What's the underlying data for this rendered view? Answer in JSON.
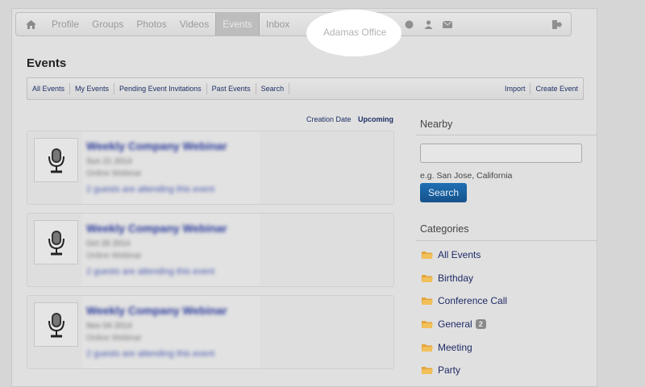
{
  "nav": {
    "items": [
      "Profile",
      "Groups",
      "Photos",
      "Videos",
      "Events",
      "Inbox"
    ],
    "office": "Adamas Office"
  },
  "page_title": "Events",
  "subnav": {
    "left": [
      "All Events",
      "My Events",
      "Pending Event Invitations",
      "Past Events",
      "Search"
    ],
    "right": [
      "Import",
      "Create Event"
    ]
  },
  "sort": {
    "creation": "Creation Date",
    "upcoming": "Upcoming"
  },
  "events": [
    {
      "title": "Weekly Company Webinar",
      "date": "Sun 21 2014",
      "type": "Online Webinar",
      "attending": "2 guests are attending this event"
    },
    {
      "title": "Weekly Company Webinar",
      "date": "Oct 28 2014",
      "type": "Online Webinar",
      "attending": "2 guests are attending this event"
    },
    {
      "title": "Weekly Company Webinar",
      "date": "Nov 04 2014",
      "type": "Online Webinar",
      "attending": "2 guests are attending this event"
    }
  ],
  "nearby": {
    "heading": "Nearby",
    "hint": "e.g. San Jose, California",
    "button": "Search"
  },
  "categories": {
    "heading": "Categories",
    "items": [
      {
        "label": "All Events",
        "badge": ""
      },
      {
        "label": "Birthday",
        "badge": ""
      },
      {
        "label": "Conference Call",
        "badge": ""
      },
      {
        "label": "General",
        "badge": "2"
      },
      {
        "label": "Meeting",
        "badge": ""
      },
      {
        "label": "Party",
        "badge": ""
      }
    ]
  },
  "colors": {
    "accent": "#15528a",
    "link": "#1f2a66",
    "folder": "#e3a53b"
  }
}
